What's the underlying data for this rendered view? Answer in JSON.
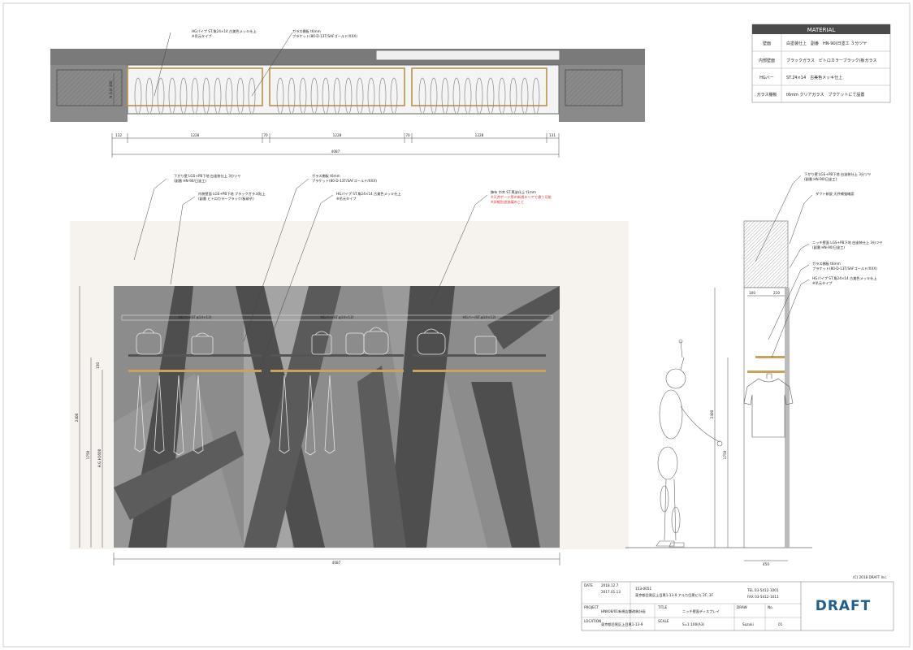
{
  "plan": {
    "dims": [
      "132",
      "1228",
      "70",
      "1228",
      "70",
      "1228",
      "131"
    ],
    "total": "4087",
    "depth": "H.G.H.300",
    "notes": [
      {
        "line1": "HGパイプ ST.角24×14 古美色メッキ仕上",
        "line2": "※吊元タイプ"
      },
      {
        "line1": "ガラス棚板 t6mm",
        "line2": "ブラケット(80-D-13T/SAFゴールド/XXX)"
      }
    ]
  },
  "material": {
    "title": "MATERIAL",
    "rows": [
      {
        "key": "壁面",
        "value": "白塗装仕上　副番　HN-90(日塗工 ３分ツヤ"
      },
      {
        "key": "内部壁面",
        "value": "ブラックガラス　ビトロカラーブラック(板ガラス"
      },
      {
        "key": "HGバー",
        "value": "ST.24×14　古美色メッキ仕上"
      },
      {
        "key": "ガラス棚板",
        "value": "t6mm クリアガラス　ブラケットにて設置"
      }
    ]
  },
  "elevation": {
    "width": "4087",
    "height": "2400",
    "h1": "1750",
    "h2": "H.G.H1600",
    "h3": "150",
    "hg_labels": [
      "HGバー(ST.φ14×12)",
      "HGバー(ST.φ14×12)",
      "HGバー(ST.φ14×12)"
    ],
    "notes": [
      {
        "line1": "下がり壁 LGS+PB下地 白塗装仕上 3分ツヤ",
        "line2": "(副番 HN-90/日塗工)"
      },
      {
        "line1": "内装壁面 LGS+PB下地 ブラックガラス貼上",
        "line2": "(副番 ビトロカラーブラック/板硝子)"
      },
      {
        "line1": "ガラス棚板 t6mm",
        "line2": "ブラケット(80-D-13T/SAFゴールド/XXX)"
      },
      {
        "line1": "HGパイプ ST.角24×14 古美色メッキ仕上",
        "line2": "※吊元タイプ"
      },
      {
        "line1": "飾布 巾木 ST.黒塗仕上 t1mm",
        "line2": "※天井ボード等の新規エリアで違う可能",
        "line3": "※詳細別途協議のこと"
      }
    ]
  },
  "section": {
    "depth": "450",
    "height": "2400",
    "h1": "1750",
    "top_dims": [
      "100",
      "210"
    ],
    "notes": [
      {
        "line1": "下がり壁 LGS+PB下地 白塗装仕上 3分ツヤ",
        "line2": "(副番 HN-90/日塗工)"
      },
      {
        "line1": "ダクト新設 天井補強確認"
      },
      {
        "line1": "ニッチ壁面 LGS+PB下地 白塗装仕上 3分ツヤ",
        "line2": "(副番 HN-90/日塗工)"
      },
      {
        "line1": "ガラス棚板 t6mm",
        "line2": "ブラケット(80-D-13T/SAFゴールド/XXX)"
      },
      {
        "line1": "HGパイプ ST.角24×14 古美色メッキ仕上",
        "line2": "※吊元タイプ"
      }
    ]
  },
  "titleblock": {
    "copyright": "(C) 2018 DRAFT Inc.",
    "date_label": "DATE",
    "dates": [
      "2018.12.7",
      "2017.01.13"
    ],
    "postcode": "153-0051",
    "address": "東京都目黒区上目黒1-13-9  アルカ目黒ビル 2F, 3F",
    "tel": "TEL  03-5412-1001",
    "fax": "FAX  03-5412-1011",
    "project_label": "PROJECT",
    "project": "HNK08/01新規店舗改装計画",
    "title_label": "TITLE",
    "title": "ニッチ壁面ディスプレイ",
    "draw_label": "DRAW",
    "no_label": "No.",
    "location_label": "LOCATION",
    "location": "東京都目黒区上目黒1-13-9",
    "scale_label": "SCALE",
    "scale": "S=1:100(A3)",
    "author": "Suzuki",
    "sheet_no": "01",
    "logo": "DRAFT"
  },
  "colors": {
    "panel_dark": "#4e4e4e",
    "panel_mid": "#8c8c8c",
    "brass": "#c9a35b",
    "logo_blue": "#1f5e8e",
    "note_red": "#e03030"
  }
}
